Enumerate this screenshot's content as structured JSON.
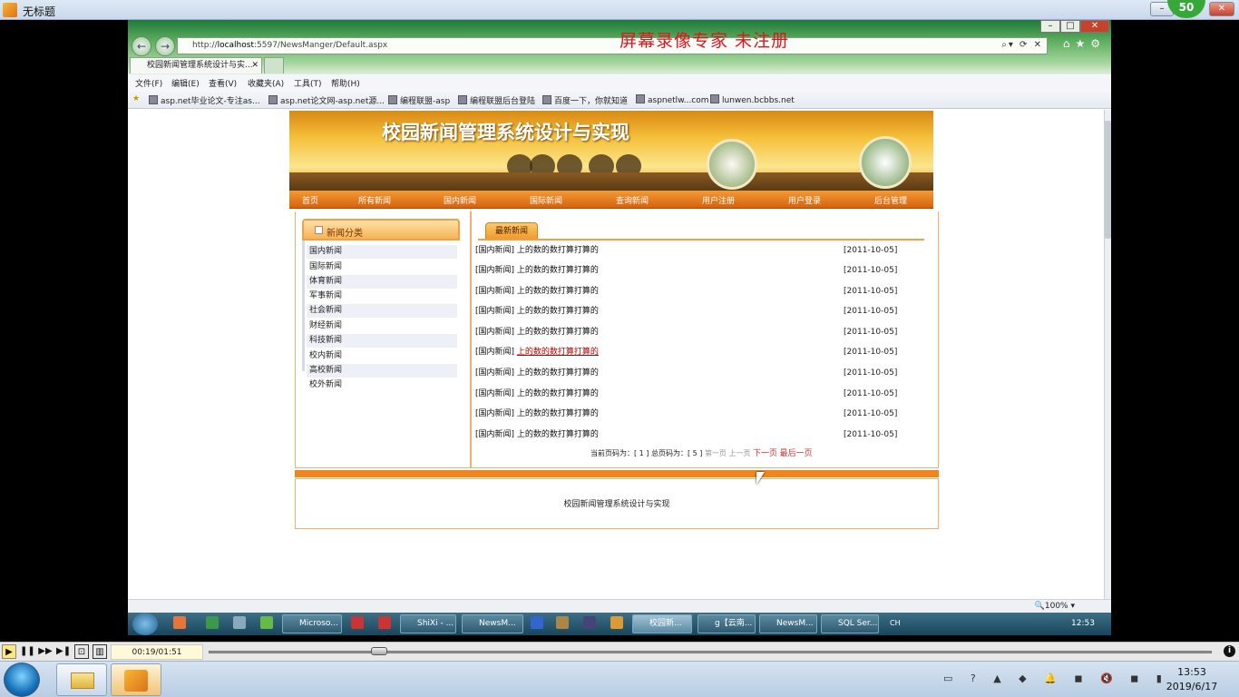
{
  "player": {
    "title": "无标题",
    "badge": "50",
    "time": "00:19/01:51",
    "progress": 0.17
  },
  "browser": {
    "url_host": "localhost",
    "url_pre": "http://",
    "url_post": ":5597/NewsManger/Default.aspx",
    "watermark": "屏幕录像专家 未注册",
    "tab_title": "校园新闻管理系统设计与实...",
    "menu": [
      "文件(F)",
      "编辑(E)",
      "查看(V)",
      "收藏夹(A)",
      "工具(T)",
      "帮助(H)"
    ],
    "favorites": [
      "asp.net毕业论文-专注as...",
      "asp.net论文网-asp.net源...",
      "编程联盟-asp",
      "编程联盟后台登陆",
      "百度一下，你就知道",
      "aspnetlw...com",
      "lunwen.bcbbs.net"
    ],
    "zoom": "100%"
  },
  "site": {
    "title": "校园新闻管理系统设计与实现",
    "nav": [
      "首页",
      "所有新闻",
      "国内新闻",
      "国际新闻",
      "查询新闻",
      "用户注册",
      "用户登录",
      "后台管理"
    ],
    "category_header": "新闻分类",
    "categories": [
      "国内新闻",
      "国际新闻",
      "体育新闻",
      "军事新闻",
      "社会新闻",
      "财经新闻",
      "科技新闻",
      "校内新闻",
      "高校新闻",
      "校外新闻"
    ],
    "latest_tab": "最新新闻",
    "news": [
      {
        "cat": "[国内新闻]",
        "title": "上的数的数打算打算的",
        "date": "[2011-10-05]"
      },
      {
        "cat": "[国内新闻]",
        "title": "上的数的数打算打算的",
        "date": "[2011-10-05]"
      },
      {
        "cat": "[国内新闻]",
        "title": "上的数的数打算打算的",
        "date": "[2011-10-05]"
      },
      {
        "cat": "[国内新闻]",
        "title": "上的数的数打算打算的",
        "date": "[2011-10-05]"
      },
      {
        "cat": "[国内新闻]",
        "title": "上的数的数打算打算的",
        "date": "[2011-10-05]"
      },
      {
        "cat": "[国内新闻]",
        "title": "上的数的数打算打算的",
        "date": "[2011-10-05]"
      },
      {
        "cat": "[国内新闻]",
        "title": "上的数的数打算打算的",
        "date": "[2011-10-05]"
      },
      {
        "cat": "[国内新闻]",
        "title": "上的数的数打算打算的",
        "date": "[2011-10-05]"
      },
      {
        "cat": "[国内新闻]",
        "title": "上的数的数打算打算的",
        "date": "[2011-10-05]"
      },
      {
        "cat": "[国内新闻]",
        "title": "上的数的数打算打算的",
        "date": "[2011-10-05]"
      }
    ],
    "pager": {
      "current_label": "当前页码为：",
      "current": "[ 1 ]",
      "total_label": "总页码为：",
      "total": "[ 5 ]",
      "first": "第一页",
      "prev": "上一页",
      "next": "下一页",
      "last": "最后一页"
    },
    "footer": "校园新闻管理系统设计与实现"
  },
  "guest_taskbar": {
    "buttons": [
      "Microso...",
      "ShiXi - ...",
      "NewsM...",
      "校园新...",
      "g【云南...",
      "NewsM...",
      "SQL Ser..."
    ],
    "tray_lang": "CH",
    "clock": "12:53"
  },
  "host_taskbar": {
    "time": "13:53",
    "date": "2019/6/17"
  },
  "colors": {
    "accent_orange": "#f0851e",
    "watermark_red": "#e0141e"
  }
}
